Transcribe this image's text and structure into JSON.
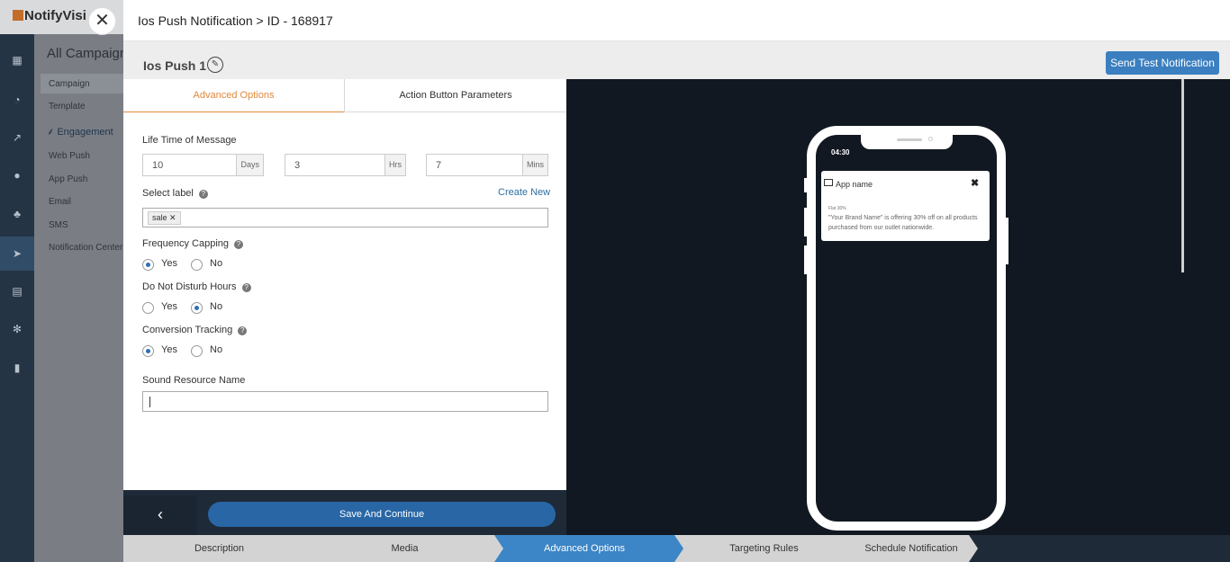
{
  "background": {
    "logo": "NotifyVisi",
    "title": "All Campaign",
    "nav": {
      "campaign": "Campaign",
      "template": "Template",
      "engagement": "Engagement",
      "web_push": "Web Push",
      "app_push": "App Push",
      "email": "Email",
      "sms": "SMS",
      "notification_center": "Notification Center"
    }
  },
  "modal": {
    "title": "Ios Push Notification > ID - 168917",
    "campaign_name": "Ios Push 1",
    "send_test_label": "Send Test Notification",
    "tabs": {
      "advanced": "Advanced Options",
      "action": "Action Button Parameters"
    },
    "form": {
      "lifetime_label": "Life Time of Message",
      "days_value": "10",
      "days_unit": "Days",
      "hrs_value": "3",
      "hrs_unit": "Hrs",
      "mins_value": "7",
      "mins_unit": "Mins",
      "select_label": "Select label",
      "create_new": "Create New",
      "tag_sale": "sale",
      "frequency_label": "Frequency Capping",
      "dnd_label": "Do Not Disturb Hours",
      "conversion_label": "Conversion Tracking",
      "yes": "Yes",
      "no": "No",
      "sound_label": "Sound Resource Name",
      "sound_value": ""
    },
    "footer": {
      "back": "‹",
      "save": "Save And Continue"
    },
    "preview": {
      "time": "04:30",
      "app_name": "App name",
      "close": "✖",
      "notif_title": "Flat 30%",
      "notif_body": "\"Your Brand Name\" is offering 30% off on all products purchased from our outlet nationwide."
    },
    "steps": [
      "Description",
      "Media",
      "Advanced Options",
      "Targeting Rules",
      "Schedule Notification"
    ],
    "active_step": "Advanced Options"
  }
}
